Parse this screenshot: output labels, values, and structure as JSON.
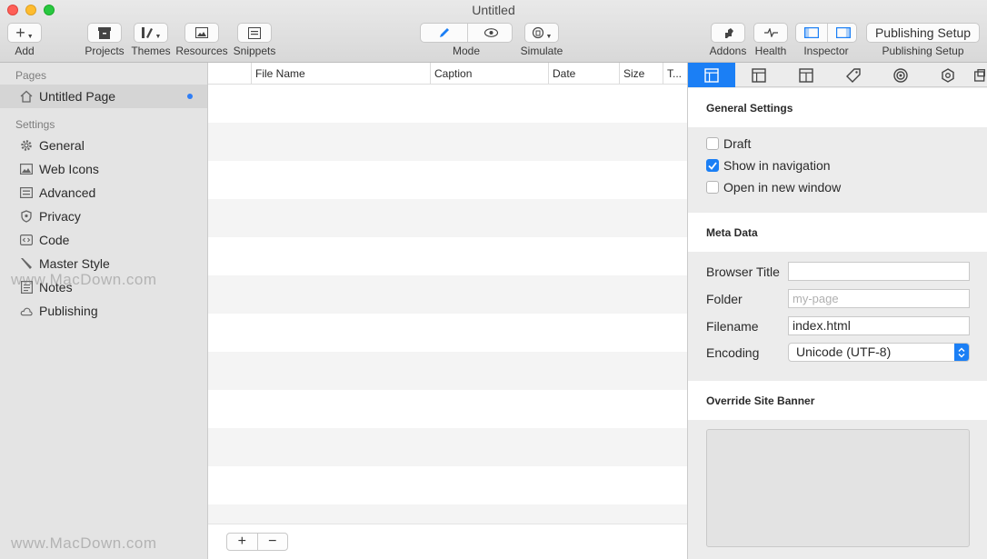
{
  "window": {
    "title": "Untitled"
  },
  "toolbar": {
    "add_label": "Add",
    "projects_label": "Projects",
    "themes_label": "Themes",
    "resources_label": "Resources",
    "snippets_label": "Snippets",
    "mode_label": "Mode",
    "simulate_label": "Simulate",
    "addons_label": "Addons",
    "health_label": "Health",
    "inspector_label": "Inspector",
    "publishing_button": "Publishing Setup",
    "publishing_label": "Publishing Setup"
  },
  "sidebar": {
    "pages_heading": "Pages",
    "pages": [
      {
        "label": "Untitled Page"
      }
    ],
    "settings_heading": "Settings",
    "settings": [
      {
        "label": "General",
        "icon": "gear-icon"
      },
      {
        "label": "Web Icons",
        "icon": "image-icon"
      },
      {
        "label": "Advanced",
        "icon": "sliders-icon"
      },
      {
        "label": "Privacy",
        "icon": "shield-icon"
      },
      {
        "label": "Code",
        "icon": "code-icon"
      },
      {
        "label": "Master Style",
        "icon": "brush-icon"
      },
      {
        "label": "Notes",
        "icon": "notes-icon"
      },
      {
        "label": "Publishing",
        "icon": "cloud-icon"
      }
    ]
  },
  "table": {
    "columns": [
      "File Name",
      "Caption",
      "Date",
      "Size",
      "T..."
    ]
  },
  "inspector": {
    "general_heading": "General Settings",
    "checkboxes": [
      {
        "label": "Draft",
        "checked": false
      },
      {
        "label": "Show in navigation",
        "checked": true
      },
      {
        "label": "Open in new window",
        "checked": false
      }
    ],
    "meta_heading": "Meta Data",
    "browser_title_label": "Browser Title",
    "browser_title_value": "",
    "folder_label": "Folder",
    "folder_placeholder": "my-page",
    "filename_label": "Filename",
    "filename_value": "index.html",
    "encoding_label": "Encoding",
    "encoding_value": "Unicode (UTF-8)",
    "banner_heading": "Override Site Banner"
  },
  "watermark": {
    "text": "www.MacDown.com"
  },
  "colors": {
    "accent": "#1b7ff5",
    "selection": "#d5d5d5",
    "dot": "#2f7ef6"
  }
}
